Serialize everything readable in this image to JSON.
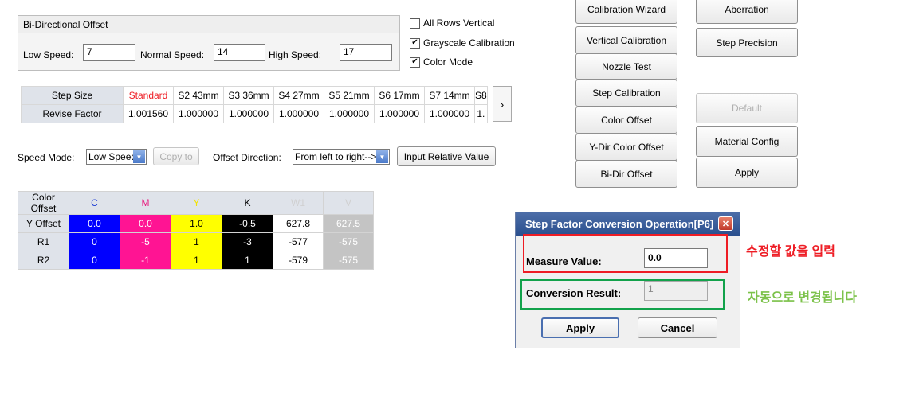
{
  "bidir": {
    "title": "Bi-Directional Offset",
    "low_label": "Low Speed:",
    "low_value": "7",
    "normal_label": "Normal Speed:",
    "normal_value": "14",
    "high_label": "High Speed:",
    "high_value": "17"
  },
  "options": {
    "all_rows_vertical": "All Rows Vertical",
    "all_rows_checked": false,
    "grayscale_calibration": "Grayscale Calibration",
    "grayscale_checked": true,
    "color_mode": "Color Mode",
    "color_mode_checked": true
  },
  "step_table": {
    "row_headers": [
      "Step Size",
      "Revise Factor"
    ],
    "columns": [
      "Standard",
      "S2 43mm",
      "S3 36mm",
      "S4 27mm",
      "S5 21mm",
      "S6 17mm",
      "S7 14mm",
      "S8"
    ],
    "values": [
      "1.001560",
      "1.000000",
      "1.000000",
      "1.000000",
      "1.000000",
      "1.000000",
      "1.000000",
      "1."
    ],
    "active_color": "#ee1c24",
    "scroll_glyph": "›"
  },
  "speed_row": {
    "speed_mode_label": "Speed Mode:",
    "speed_mode_value": "Low Speed",
    "copy_to": "Copy to",
    "offset_direction_label": "Offset Direction:",
    "offset_direction_value": "From left to right-->",
    "input_relative": "Input Relative Value"
  },
  "color_offset": {
    "header": [
      "Color Offset",
      "C",
      "M",
      "Y",
      "K",
      "W1",
      "V"
    ],
    "header_colors": [
      "#000000",
      "#1f3fd4",
      "#e8197d",
      "#f2e300",
      "#000000",
      "#d0d0d0",
      "#d0d0d0"
    ],
    "rows": [
      {
        "label": "Y Offset",
        "values": [
          "0.0",
          "0.0",
          "1.0",
          "-0.5",
          "627.8",
          "627.5"
        ]
      },
      {
        "label": "R1",
        "values": [
          "0",
          "-5",
          "1",
          "-3",
          "-577",
          "-575"
        ]
      },
      {
        "label": "R2",
        "values": [
          "0",
          "-1",
          "1",
          "1",
          "-579",
          "-575"
        ]
      }
    ],
    "cell_bg": [
      "#0000ff",
      "#ff1493",
      "#ffff00",
      "#000000",
      "#ffffff",
      "#c4c4c4"
    ],
    "cell_fg": [
      "#ffffff",
      "#ffffff",
      "#000000",
      "#ffffff",
      "#000000",
      "#ffffff"
    ]
  },
  "buttons_col1": [
    "Calibration Wizard",
    "Vertical Calibration",
    "Nozzle Test",
    "Step Calibration",
    "Color Offset",
    "Y-Dir Color Offset",
    "Bi-Dir Offset"
  ],
  "buttons_col2": [
    "Aberration",
    "Step Precision",
    "Default",
    "Material Config",
    "Apply"
  ],
  "dialog": {
    "title": "Step Factor Conversion Operation[P6]",
    "measure_label": "Measure Value:",
    "measure_value": "0.0",
    "conversion_label": "Conversion Result:",
    "conversion_value": "1",
    "apply": "Apply",
    "cancel": "Cancel"
  },
  "annotations": {
    "red_note": "수정할 값을 입력",
    "green_note": "자동으로 변경됩니다"
  }
}
